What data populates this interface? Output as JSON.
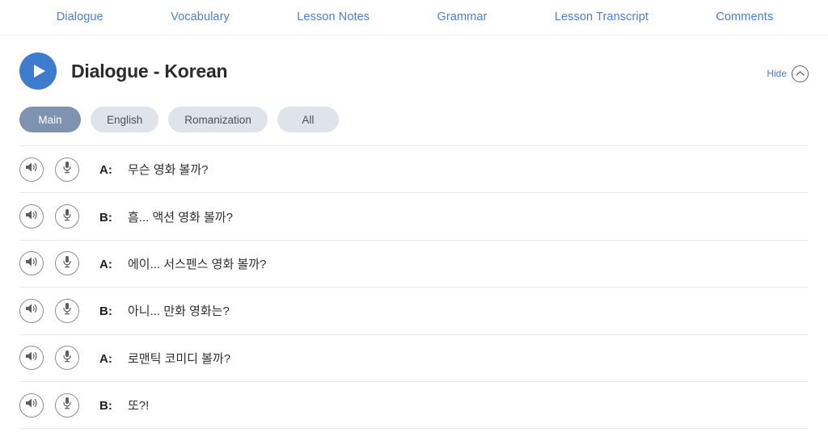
{
  "topnav": {
    "tabs": [
      {
        "label": "Dialogue"
      },
      {
        "label": "Vocabulary"
      },
      {
        "label": "Lesson Notes"
      },
      {
        "label": "Grammar"
      },
      {
        "label": "Lesson Transcript"
      },
      {
        "label": "Comments"
      }
    ]
  },
  "header": {
    "title": "Dialogue - Korean",
    "play_icon": "play-icon",
    "hide_label": "Hide",
    "hide_icon": "chevron-up-icon"
  },
  "filters": {
    "pills": [
      {
        "label": "Main",
        "active": true
      },
      {
        "label": "English",
        "active": false
      },
      {
        "label": "Romanization",
        "active": false
      },
      {
        "label": "All",
        "active": false
      }
    ]
  },
  "dialogue": {
    "audio_icon": "speaker-icon",
    "record_icon": "microphone-icon",
    "lines": [
      {
        "speaker": "A:",
        "text": "무슨 영화 볼까?"
      },
      {
        "speaker": "B:",
        "text": "흠... 액션 영화 볼까?"
      },
      {
        "speaker": "A:",
        "text": "에이... 서스펜스 영화 볼까?"
      },
      {
        "speaker": "B:",
        "text": "아니... 만화 영화는?"
      },
      {
        "speaker": "A:",
        "text": "로맨틱 코미디 볼까?"
      },
      {
        "speaker": "B:",
        "text": "또?!"
      }
    ]
  },
  "colors": {
    "link_blue": "#4a7ee0",
    "play_blue": "#3d7ccc",
    "pill_active": "#7e93b0",
    "pill_inactive": "#dfe4ea",
    "divider": "#e6e8ea"
  }
}
